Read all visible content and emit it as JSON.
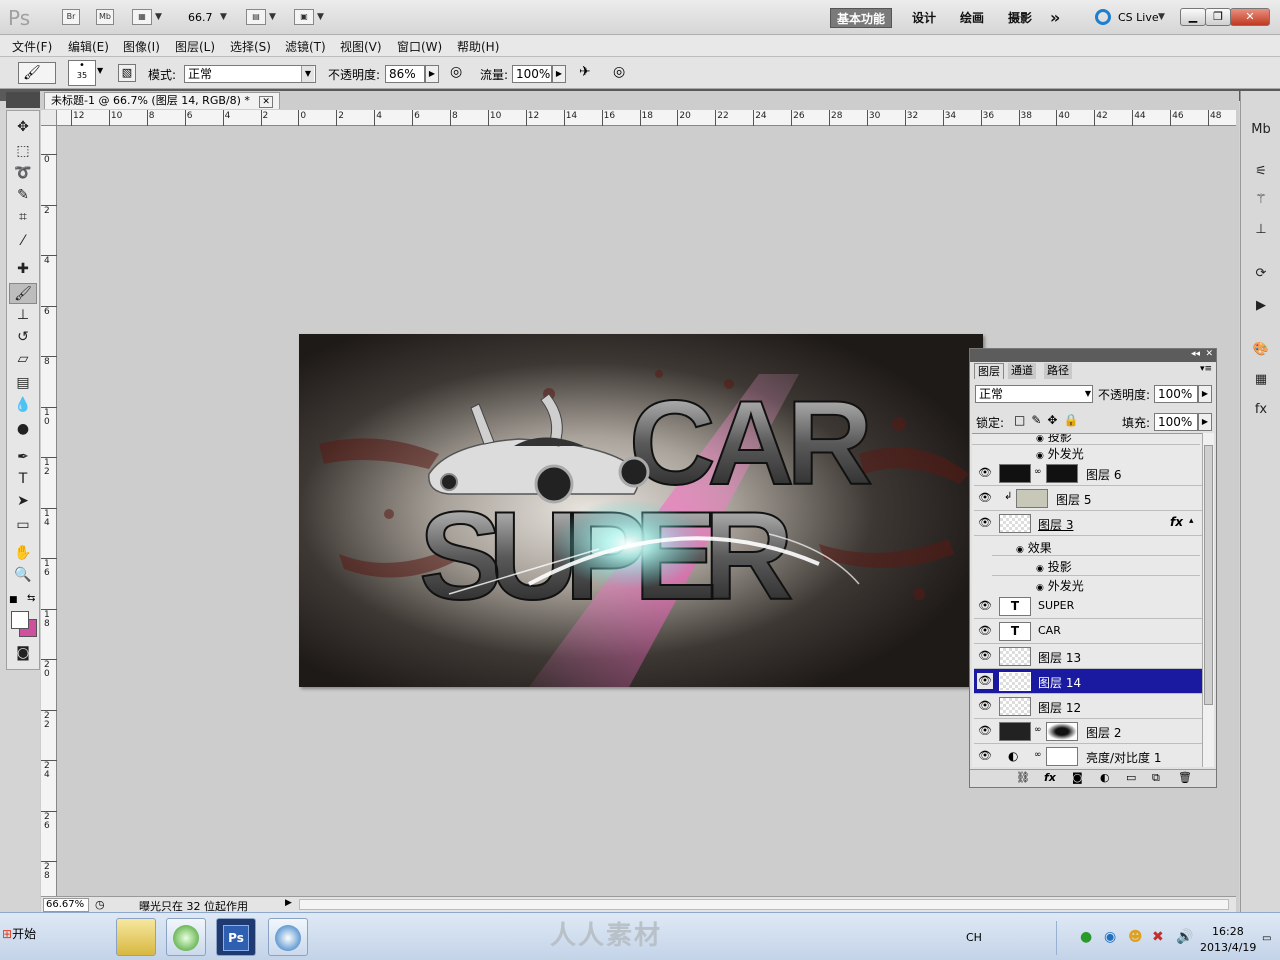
{
  "app": {
    "logo": "Ps",
    "bridge_icon": "Br",
    "minibridge_icon": "Mb",
    "zoom_value": "66.7",
    "workspaces": [
      "基本功能",
      "设计",
      "绘画",
      "摄影"
    ],
    "more_workspaces": "»",
    "cs_live": "CS Live",
    "window_controls": [
      "minimize",
      "restore",
      "close"
    ]
  },
  "menu": [
    "文件(F)",
    "编辑(E)",
    "图像(I)",
    "图层(L)",
    "选择(S)",
    "滤镜(T)",
    "视图(V)",
    "窗口(W)",
    "帮助(H)"
  ],
  "options": {
    "brush_size": "35",
    "mode_label": "模式:",
    "mode_value": "正常",
    "opacity_label": "不透明度:",
    "opacity_value": "86%",
    "flow_label": "流量:",
    "flow_value": "100%"
  },
  "document": {
    "tab_title": "未标题-1 @ 66.7% (图层 14, RGB/8) *",
    "zoom_status": "66.67%",
    "status_text": "曝光只在 32 位起作用",
    "h_ruler": [
      "12",
      "10",
      "8",
      "6",
      "4",
      "2",
      "0",
      "2",
      "4",
      "6",
      "8",
      "10",
      "12",
      "14",
      "16",
      "18",
      "20",
      "22",
      "24",
      "26",
      "28",
      "30",
      "32",
      "34",
      "36",
      "38",
      "40",
      "42",
      "44",
      "46",
      "48"
    ],
    "v_ruler": [
      "0",
      "2",
      "4",
      "6",
      "8",
      "1\n0",
      "1\n2",
      "1\n4",
      "1\n6",
      "1\n8",
      "2\n0",
      "2\n2",
      "2\n4",
      "2\n6",
      "2\n8"
    ]
  },
  "artwork": {
    "text_top": "CAR",
    "text_bottom": "SUPER"
  },
  "layers_panel": {
    "tabs": [
      "图层",
      "通道",
      "路径"
    ],
    "blend_mode": "正常",
    "opacity_label": "不透明度:",
    "opacity_value": "100%",
    "lock_label": "锁定:",
    "fill_label": "填充:",
    "fill_value": "100%",
    "rows": [
      {
        "type": "effect",
        "name": "投影"
      },
      {
        "type": "effect",
        "name": "外发光"
      },
      {
        "type": "layer",
        "name": "图层 6"
      },
      {
        "type": "layer",
        "name": "图层 5"
      },
      {
        "type": "layer",
        "name": "图层 3",
        "fx": "fx"
      },
      {
        "type": "effects-header",
        "name": "效果"
      },
      {
        "type": "effect",
        "name": "投影"
      },
      {
        "type": "effect",
        "name": "外发光"
      },
      {
        "type": "text",
        "name": "SUPER",
        "glyph": "T"
      },
      {
        "type": "text",
        "name": "CAR",
        "glyph": "T"
      },
      {
        "type": "layer",
        "name": "图层 13"
      },
      {
        "type": "layer",
        "name": "图层 14",
        "selected": true
      },
      {
        "type": "layer",
        "name": "图层 12"
      },
      {
        "type": "layer",
        "name": "图层 2"
      },
      {
        "type": "adjustment",
        "name": "亮度/对比度 1"
      }
    ]
  },
  "taskbar": {
    "start_label": "开始",
    "language": "CH",
    "time": "16:28",
    "date": "2013/4/19",
    "watermark": "人人素材"
  },
  "colors": {
    "selection": "#1a1aa0",
    "foreground_swatch": "#ffffff",
    "background_swatch": "#d050a0"
  }
}
